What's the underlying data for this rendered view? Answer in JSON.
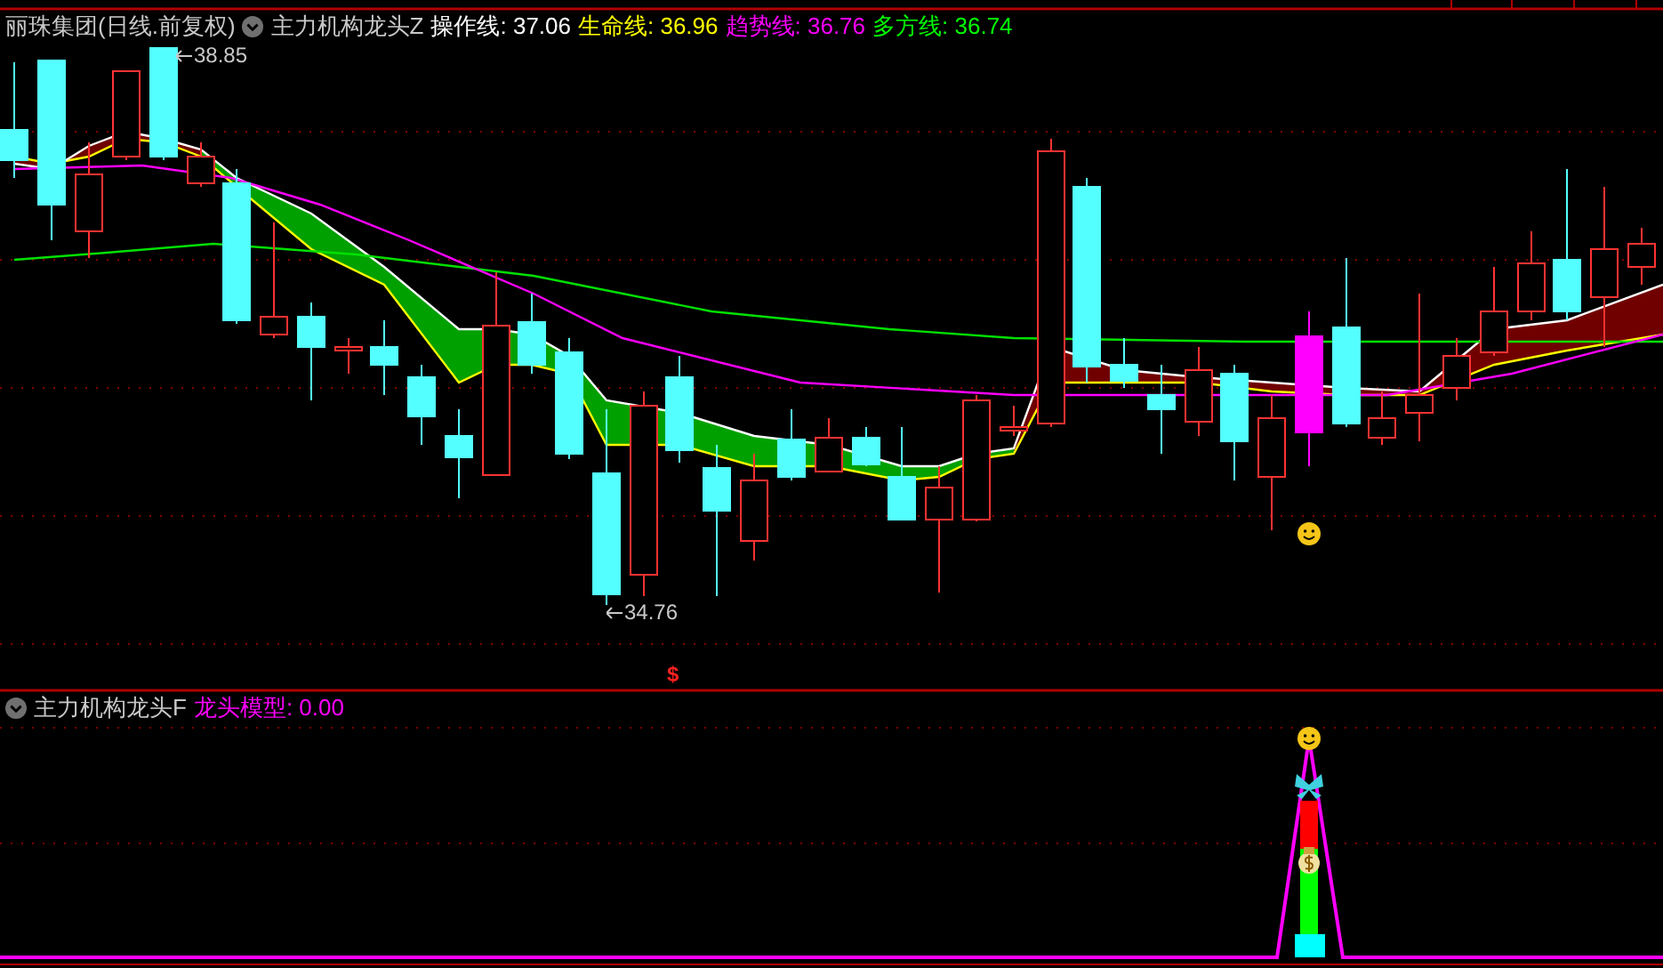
{
  "main_panel": {
    "title": "丽珠集团(日线.前复权)",
    "indicator": "主力机构龙头Z",
    "readings": [
      {
        "label": "操作线:",
        "value": "37.06",
        "color": "#ffffff"
      },
      {
        "label": "生命线:",
        "value": "36.96",
        "color": "#ffff00"
      },
      {
        "label": "趋势线:",
        "value": "36.76",
        "color": "#ff00ff"
      },
      {
        "label": "多方线:",
        "value": "36.74",
        "color": "#00ff00"
      }
    ],
    "high_label": "38.85",
    "low_label": "34.76",
    "marker": "$"
  },
  "lower_panel": {
    "indicator": "主力机构龙头F",
    "readings": [
      {
        "label": "龙头模型:",
        "value": "0.00",
        "color": "#ff00ff"
      }
    ]
  }
}
